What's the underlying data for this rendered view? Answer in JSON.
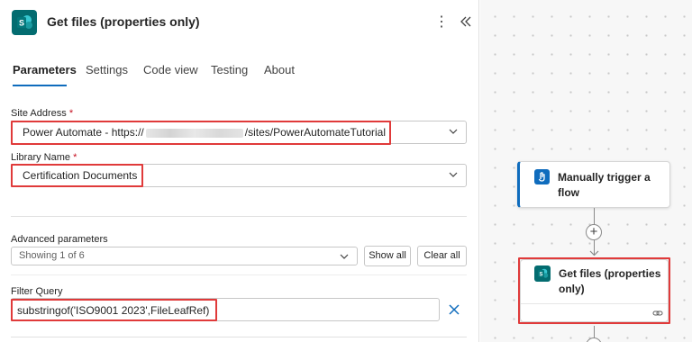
{
  "panel": {
    "title": "Get files (properties only)",
    "app_icon": "sharepoint-icon",
    "more_icon": "more-vertical-icon",
    "collapse_icon": "double-chevron-left-icon",
    "tabs": [
      {
        "label": "Parameters",
        "active": true
      },
      {
        "label": "Settings",
        "active": false
      },
      {
        "label": "Code view",
        "active": false
      },
      {
        "label": "Testing",
        "active": false
      },
      {
        "label": "About",
        "active": false
      }
    ],
    "site_address": {
      "label": "Site Address",
      "required_mark": "*",
      "value_prefix": "Power Automate - https://",
      "value_suffix": "/sites/PowerAutomateTutorial"
    },
    "library_name": {
      "label": "Library Name",
      "required_mark": "*",
      "value": "Certification Documents"
    },
    "advanced": {
      "label": "Advanced parameters",
      "value": "Showing 1 of 6",
      "show_all": "Show all",
      "clear_all": "Clear all"
    },
    "filter_query": {
      "label": "Filter Query",
      "value": "substringof('ISO9001 2023',FileLeafRef)"
    }
  },
  "canvas": {
    "trigger_card": {
      "title": "Manually trigger a flow",
      "icon": "manual-trigger-icon",
      "accent": "#0f6cbd"
    },
    "action_card": {
      "title": "Get files (properties only)",
      "icon": "sharepoint-icon",
      "footer_icon": "link-icon"
    },
    "add_icon": "plus-icon"
  },
  "colors": {
    "accent": "#0f6cbd",
    "highlight": "#e03a3a",
    "sharepoint": "#036c70",
    "required": "#c50f1f"
  }
}
